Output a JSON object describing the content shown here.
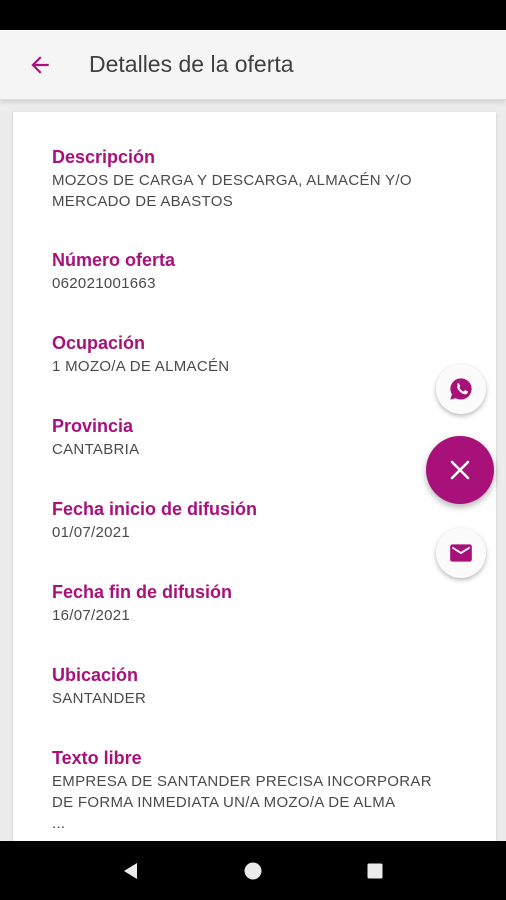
{
  "header": {
    "title": "Detalles de la oferta",
    "back_icon": "arrow-back-icon"
  },
  "colors": {
    "accent": "#a8117a",
    "title": "#3f3f3f",
    "value": "#4a4a4a"
  },
  "fields": {
    "descripcion": {
      "label": "Descripción",
      "value": "MOZOS DE CARGA Y DESCARGA, ALMACÉN Y/O\nMERCADO DE ABASTOS"
    },
    "numero": {
      "label": "Número oferta",
      "value": "062021001663"
    },
    "ocupacion": {
      "label": "Ocupación",
      "value": "1 MOZO/A DE ALMACÉN"
    },
    "provincia": {
      "label": "Provincia",
      "value": "CANTABRIA"
    },
    "fecha_inicio": {
      "label": "Fecha inicio de difusión",
      "value": "01/07/2021"
    },
    "fecha_fin": {
      "label": "Fecha fin de difusión",
      "value": "16/07/2021"
    },
    "ubicacion": {
      "label": "Ubicación",
      "value": "SANTANDER"
    },
    "texto_libre": {
      "label": "Texto libre",
      "value": "EMPRESA DE SANTANDER PRECISA INCORPORAR\nDE FORMA INMEDIATA UN/A MOZO/A DE ALMA\n..."
    }
  },
  "fabs": {
    "whatsapp": "whatsapp-icon",
    "close": "close-icon",
    "email": "email-icon"
  },
  "navigation": {
    "back": "nav-back-icon",
    "home": "nav-home-icon",
    "recents": "nav-recents-icon"
  }
}
